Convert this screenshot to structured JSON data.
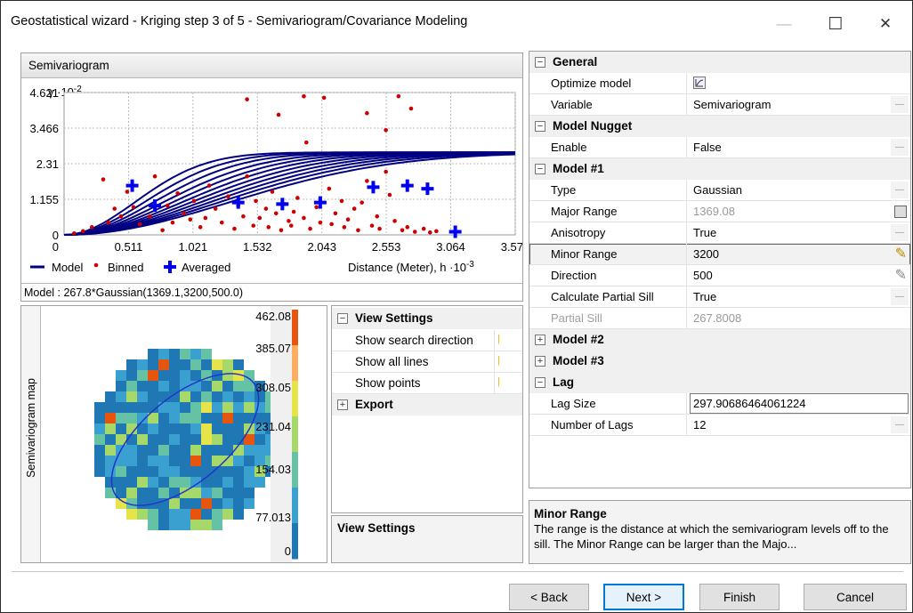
{
  "window": {
    "title": "Geostatistical wizard - Kriging step 3 of 5 - Semivariogram/Covariance Modeling",
    "minimize_glyph": "—",
    "maximize_glyph": "☐",
    "close_glyph": "✕"
  },
  "semivariogram": {
    "header": "Semivariogram",
    "ylabel": "γ ·10",
    "ylabel_exp": "-2",
    "xlabel": "Distance (Meter), h ·10",
    "xlabel_exp": "-3",
    "legend": {
      "model": "Model",
      "binned": "Binned",
      "averaged": "Averaged"
    },
    "model_text": "Model : 267.8*Gaussian(1369.1,3200,500.0)"
  },
  "chart_data": {
    "type": "scatter",
    "title": "Semivariogram",
    "xlabel": "Distance (Meter), h ·10-3",
    "ylabel": "γ ·10-2",
    "x_ticks": [
      "0.511",
      "1.021",
      "1.532",
      "2.043",
      "2.553",
      "3.064",
      "3.575"
    ],
    "y_ticks": [
      "0",
      "1.155",
      "2.31",
      "3.466",
      "4.621"
    ],
    "xlim": [
      0,
      3.575
    ],
    "ylim": [
      0,
      4.621
    ],
    "sill": 2.678,
    "model_ranges": [
      1.369,
      1.55,
      1.73,
      1.92,
      2.1,
      2.28,
      2.46,
      2.64,
      2.82,
      3.0,
      3.2
    ],
    "binned": [
      [
        0.08,
        0.05
      ],
      [
        0.15,
        0.12
      ],
      [
        0.22,
        0.25
      ],
      [
        0.31,
        1.8
      ],
      [
        0.35,
        0.4
      ],
      [
        0.4,
        0.85
      ],
      [
        0.45,
        0.6
      ],
      [
        0.5,
        1.4
      ],
      [
        0.55,
        0.9
      ],
      [
        0.6,
        0.35
      ],
      [
        0.68,
        0.6
      ],
      [
        0.72,
        1.9
      ],
      [
        0.78,
        0.15
      ],
      [
        0.82,
        0.95
      ],
      [
        0.86,
        0.4
      ],
      [
        0.9,
        1.35
      ],
      [
        0.95,
        0.7
      ],
      [
        1.0,
        0.5
      ],
      [
        1.03,
        1.1
      ],
      [
        1.08,
        0.25
      ],
      [
        1.12,
        0.55
      ],
      [
        1.15,
        1.6
      ],
      [
        1.2,
        0.85
      ],
      [
        1.25,
        0.4
      ],
      [
        1.3,
        1.25
      ],
      [
        1.35,
        0.2
      ],
      [
        1.38,
        0.95
      ],
      [
        1.42,
        0.6
      ],
      [
        1.45,
        1.9
      ],
      [
        1.5,
        0.3
      ],
      [
        1.52,
        1.1
      ],
      [
        1.55,
        0.55
      ],
      [
        1.6,
        0.85
      ],
      [
        1.62,
        0.25
      ],
      [
        1.65,
        1.4
      ],
      [
        1.68,
        0.7
      ],
      [
        1.72,
        0.15
      ],
      [
        1.75,
        1.0
      ],
      [
        1.78,
        0.45
      ],
      [
        1.8,
        0.3
      ],
      [
        1.82,
        0.75
      ],
      [
        1.85,
        1.2
      ],
      [
        1.9,
        0.55
      ],
      [
        1.92,
        3.0
      ],
      [
        1.95,
        0.2
      ],
      [
        2.0,
        0.9
      ],
      [
        2.03,
        0.4
      ],
      [
        2.06,
        4.45
      ],
      [
        2.1,
        1.5
      ],
      [
        2.12,
        0.35
      ],
      [
        2.15,
        0.7
      ],
      [
        2.2,
        1.1
      ],
      [
        2.22,
        0.25
      ],
      [
        2.25,
        0.5
      ],
      [
        2.3,
        0.85
      ],
      [
        2.33,
        0.15
      ],
      [
        2.36,
        1.05
      ],
      [
        2.4,
        1.75
      ],
      [
        2.44,
        0.3
      ],
      [
        2.48,
        0.6
      ],
      [
        2.5,
        0.2
      ],
      [
        2.55,
        3.4
      ],
      [
        2.58,
        1.3
      ],
      [
        2.62,
        0.45
      ],
      [
        2.65,
        4.5
      ],
      [
        2.68,
        0.15
      ],
      [
        2.72,
        0.25
      ],
      [
        2.75,
        4.1
      ],
      [
        2.78,
        0.1
      ],
      [
        2.85,
        0.2
      ],
      [
        2.9,
        0.08
      ],
      [
        2.95,
        0.12
      ],
      [
        1.45,
        4.4
      ],
      [
        1.9,
        4.5
      ],
      [
        2.4,
        3.95
      ],
      [
        2.55,
        2.05
      ],
      [
        1.7,
        3.9
      ]
    ],
    "averaged": [
      [
        0.54,
        1.6
      ],
      [
        0.72,
        0.95
      ],
      [
        1.38,
        1.05
      ],
      [
        1.73,
        1.0
      ],
      [
        2.03,
        1.05
      ],
      [
        2.45,
        1.55
      ],
      [
        2.72,
        1.6
      ],
      [
        2.88,
        1.5
      ],
      [
        3.1,
        0.1
      ]
    ]
  },
  "map": {
    "label": "Semivariogram map",
    "scale_values": [
      "462.08",
      "385.07",
      "308.05",
      "231.04",
      "154.03",
      "77.013",
      "0"
    ],
    "scale_colors": [
      "#e6550d",
      "#fdae61",
      "#e6e44a",
      "#a6d96a",
      "#66c2a5",
      "#3aa0d0",
      "#1f78b4"
    ]
  },
  "view_settings": {
    "header": "View Settings",
    "items": [
      "Show search direction",
      "Show all lines",
      "Show points"
    ],
    "export": "Export",
    "desc_title": "View Settings"
  },
  "props": {
    "general": "General",
    "optimize_model": "Optimize model",
    "variable_k": "Variable",
    "variable_v": "Semivariogram",
    "model_nugget": "Model Nugget",
    "enable_k": "Enable",
    "enable_v": "False",
    "model1": "Model #1",
    "type_k": "Type",
    "type_v": "Gaussian",
    "major_k": "Major Range",
    "major_v": "1369.08",
    "aniso_k": "Anisotropy",
    "aniso_v": "True",
    "minor_k": "Minor Range",
    "minor_v": "3200",
    "dir_k": "Direction",
    "dir_v": "500",
    "cps_k": "Calculate Partial Sill",
    "cps_v": "True",
    "ps_k": "Partial Sill",
    "ps_v": "267.8008",
    "model2": "Model #2",
    "model3": "Model #3",
    "lag": "Lag",
    "lagsize_k": "Lag Size",
    "lagsize_v": "297.90686464061224",
    "nlags_k": "Number of Lags",
    "nlags_v": "12"
  },
  "description": {
    "title": "Minor Range",
    "text": "The range is the distance at which the semivariogram levels off to the sill. The Minor Range can be larger than the Majo..."
  },
  "buttons": {
    "back": "< Back",
    "next": "Next >",
    "finish": "Finish",
    "cancel": "Cancel"
  }
}
